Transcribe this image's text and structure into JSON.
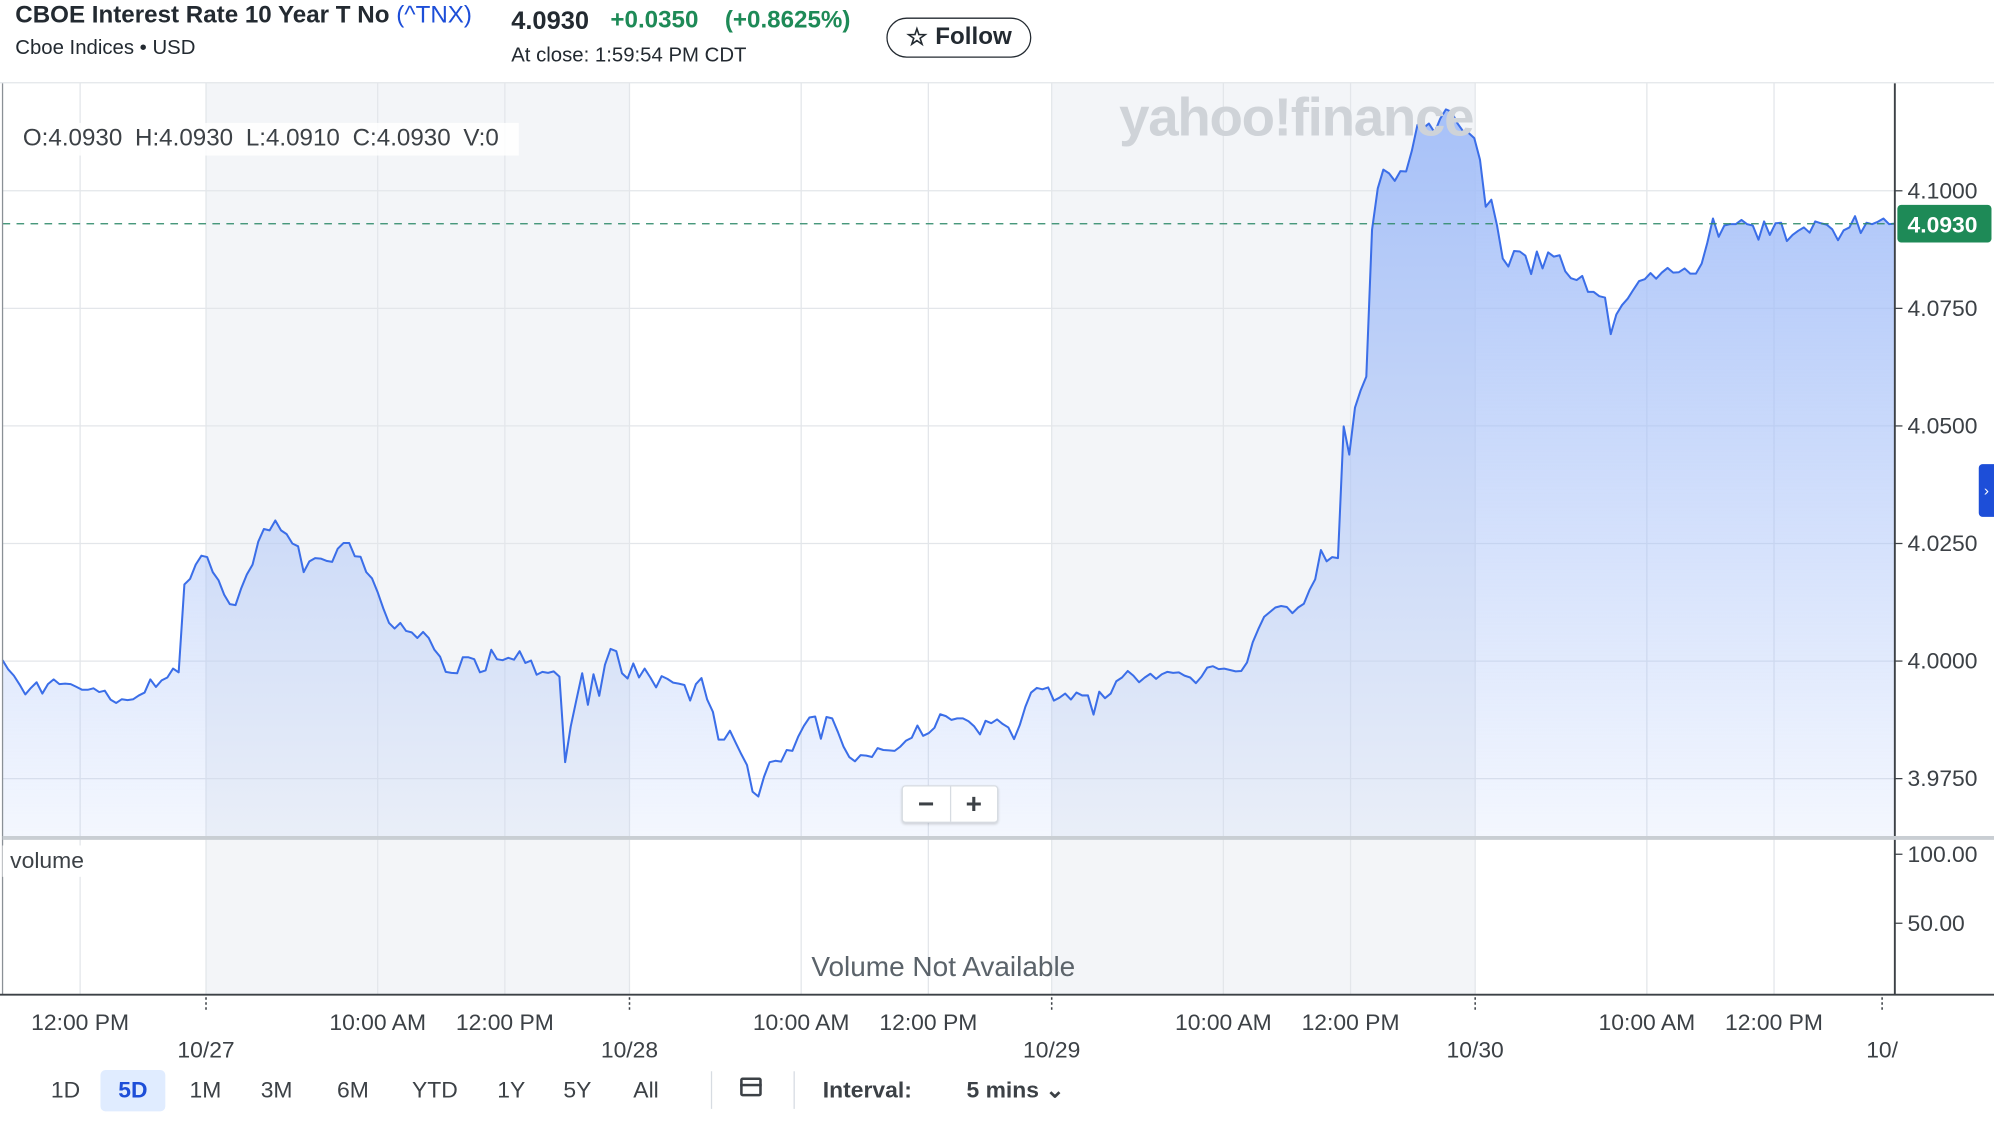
{
  "header": {
    "title": "CBOE Interest Rate 10 Year T No",
    "symbol": "(^TNX)",
    "exchange": "Cboe Indices • USD",
    "price": "4.0930",
    "change": "+0.0350",
    "change_pct": "(+0.8625%)",
    "close_time": "At close: 1:59:54 PM CDT",
    "follow_label": "Follow",
    "follow_icon": "star-outline-icon"
  },
  "overlay": {
    "open": "O:4.0930",
    "high": "H:4.0930",
    "low": "L:4.0910",
    "close": "C:4.0930",
    "volume": "V:0",
    "watermark": "yahoo!finance",
    "volume_label": "volume",
    "volume_na": "Volume Not Available",
    "zoom_out": "−",
    "zoom_in": "+",
    "last_price_label": "4.0930"
  },
  "toolbar": {
    "ranges": [
      "1D",
      "5D",
      "1M",
      "3M",
      "6M",
      "YTD",
      "1Y",
      "5Y",
      "All"
    ],
    "active_range": "5D",
    "interval_label": "Interval:",
    "interval_value": "5 mins ⌄",
    "calendar_icon": "calendar-icon"
  },
  "colors": {
    "line": "#3b6ee8",
    "area_top": "#a3bef8",
    "up": "#1e8a57",
    "link": "#1d4ed8",
    "last_price_bg": "#1e8a57"
  },
  "chart_data": {
    "type": "area",
    "symbol": "^TNX",
    "ylim": [
      3.9662,
      4.1257
    ],
    "y_ticks": [
      "4.1000",
      "4.0750",
      "4.0500",
      "4.0250",
      "4.0000",
      "3.9750"
    ],
    "volume_ticks": [
      "100.00",
      "50.00"
    ],
    "x_ticks": [
      {
        "label": "12:00 PM",
        "bold": false
      },
      {
        "label": "10/27",
        "bold": true
      },
      {
        "label": "10:00 AM",
        "bold": false
      },
      {
        "label": "12:00 PM",
        "bold": false
      },
      {
        "label": "10/28",
        "bold": true
      },
      {
        "label": "10:00 AM",
        "bold": false
      },
      {
        "label": "12:00 PM",
        "bold": false
      },
      {
        "label": "10/29",
        "bold": true
      },
      {
        "label": "10:00 AM",
        "bold": false
      },
      {
        "label": "12:00 PM",
        "bold": false
      },
      {
        "label": "10/30",
        "bold": true
      },
      {
        "label": "10:00 AM",
        "bold": false
      },
      {
        "label": "12:00 PM",
        "bold": false
      },
      {
        "label": "10/",
        "bold": true
      }
    ],
    "last_price": 4.093,
    "grid": true,
    "series": [
      {
        "name": "^TNX",
        "values": [
          4.0002,
          3.9982,
          3.9969,
          3.995,
          3.9929,
          3.9943,
          3.9955,
          3.9931,
          3.9951,
          3.9961,
          3.9951,
          3.9952,
          3.9951,
          3.9945,
          3.9939,
          3.9939,
          3.9942,
          3.9934,
          3.9937,
          3.9918,
          3.9911,
          3.9919,
          3.9917,
          3.9919,
          3.9927,
          3.9933,
          3.9961,
          3.9945,
          3.9959,
          3.9965,
          3.9984,
          3.9976,
          4.0163,
          4.0175,
          4.0205,
          4.0224,
          4.0221,
          4.0189,
          4.0172,
          4.0141,
          4.0121,
          4.0119,
          4.0155,
          4.0184,
          4.0205,
          4.0254,
          4.0281,
          4.0278,
          4.0299,
          4.0278,
          4.027,
          4.025,
          4.0244,
          4.0189,
          4.0212,
          4.0219,
          4.0218,
          4.0213,
          4.0211,
          4.0239,
          4.0251,
          4.0251,
          4.0223,
          4.0222,
          4.0189,
          4.0176,
          4.0147,
          4.0112,
          4.0081,
          4.0069,
          4.0081,
          4.0064,
          4.0061,
          4.0049,
          4.0062,
          4.0049,
          4.0024,
          4.0009,
          3.9977,
          3.9975,
          3.9974,
          4.0008,
          4.0008,
          4.0004,
          3.9976,
          3.998,
          4.0024,
          4.0004,
          4.0002,
          4.0007,
          4.0003,
          4.0021,
          3.9996,
          4.0001,
          3.9971,
          3.9977,
          3.9975,
          3.9978,
          3.9967,
          3.9785,
          3.9861,
          3.9918,
          3.9974,
          3.9907,
          3.9972,
          3.9926,
          3.9992,
          4.0026,
          4.0021,
          3.9974,
          3.9963,
          3.9995,
          3.9965,
          3.9984,
          3.9965,
          3.9944,
          3.9968,
          3.9962,
          3.9954,
          3.9952,
          3.9949,
          3.9916,
          3.9951,
          3.9964,
          3.9918,
          3.9892,
          3.9833,
          3.9833,
          3.9852,
          3.9827,
          3.9802,
          3.9779,
          3.9722,
          3.9712,
          3.9754,
          3.9785,
          3.9788,
          3.9786,
          3.9811,
          3.9809,
          3.9839,
          3.9862,
          3.988,
          3.9882,
          3.9835,
          3.9881,
          3.9878,
          3.9849,
          3.9818,
          3.9796,
          3.9787,
          3.98,
          3.9799,
          3.9796,
          3.9815,
          3.9811,
          3.981,
          3.9809,
          3.9818,
          3.9831,
          3.9837,
          3.9863,
          3.9841,
          3.9847,
          3.9858,
          3.9887,
          3.9883,
          3.9875,
          3.9878,
          3.9878,
          3.9872,
          3.9861,
          3.9844,
          3.9873,
          3.9868,
          3.9876,
          3.9866,
          3.9859,
          3.9834,
          3.9864,
          3.9903,
          3.9933,
          3.9943,
          3.994,
          3.9944,
          3.9916,
          3.9922,
          3.9931,
          3.9918,
          3.9933,
          3.9927,
          3.9927,
          3.9886,
          3.9935,
          3.9921,
          3.9931,
          3.9957,
          3.9965,
          3.9979,
          3.9969,
          3.9955,
          3.9965,
          3.9973,
          3.9962,
          3.9972,
          3.9977,
          3.9975,
          3.9976,
          3.9969,
          3.9965,
          3.9953,
          3.9967,
          3.9986,
          3.9989,
          3.9983,
          3.9984,
          3.9981,
          3.9978,
          3.9979,
          3.9997,
          4.004,
          4.0068,
          4.0094,
          4.0104,
          4.0114,
          4.0117,
          4.0115,
          4.0102,
          4.0114,
          4.0122,
          4.0151,
          4.0174,
          4.0236,
          4.0212,
          4.0221,
          4.0219,
          4.0499,
          4.0439,
          4.0539,
          4.0576,
          4.0605,
          4.0917,
          4.1005,
          4.1045,
          4.1037,
          4.1021,
          4.1042,
          4.1041,
          4.1085,
          4.114,
          4.1133,
          4.1143,
          4.1124,
          4.1153,
          4.1173,
          4.1168,
          4.1144,
          4.1127,
          4.1123,
          4.1112,
          4.1066,
          4.0966,
          4.0981,
          4.0926,
          4.0856,
          4.0839,
          4.0872,
          4.0871,
          4.0862,
          4.0823,
          4.0871,
          4.0835,
          4.0869,
          4.086,
          4.0863,
          4.0829,
          4.0814,
          4.081,
          4.0819,
          4.0785,
          4.0785,
          4.0776,
          4.0773,
          4.0695,
          4.0737,
          4.0757,
          4.0771,
          4.079,
          4.0808,
          4.0812,
          4.0825,
          4.0813,
          4.0826,
          4.0836,
          4.0826,
          4.0827,
          4.0835,
          4.0824,
          4.0824,
          4.0845,
          4.0889,
          4.0941,
          4.0902,
          4.0926,
          4.0929,
          4.0929,
          4.0938,
          4.0929,
          4.0926,
          4.0896,
          4.0935,
          4.0906,
          4.0931,
          4.0932,
          4.0893,
          4.0906,
          4.0915,
          4.0922,
          4.0911,
          4.0935,
          4.0931,
          4.0928,
          4.0918,
          4.0895,
          4.0916,
          4.0922,
          4.0946,
          4.091,
          4.0932,
          4.0929,
          4.0934,
          4.0941,
          4.0929,
          4.093
        ]
      }
    ]
  }
}
